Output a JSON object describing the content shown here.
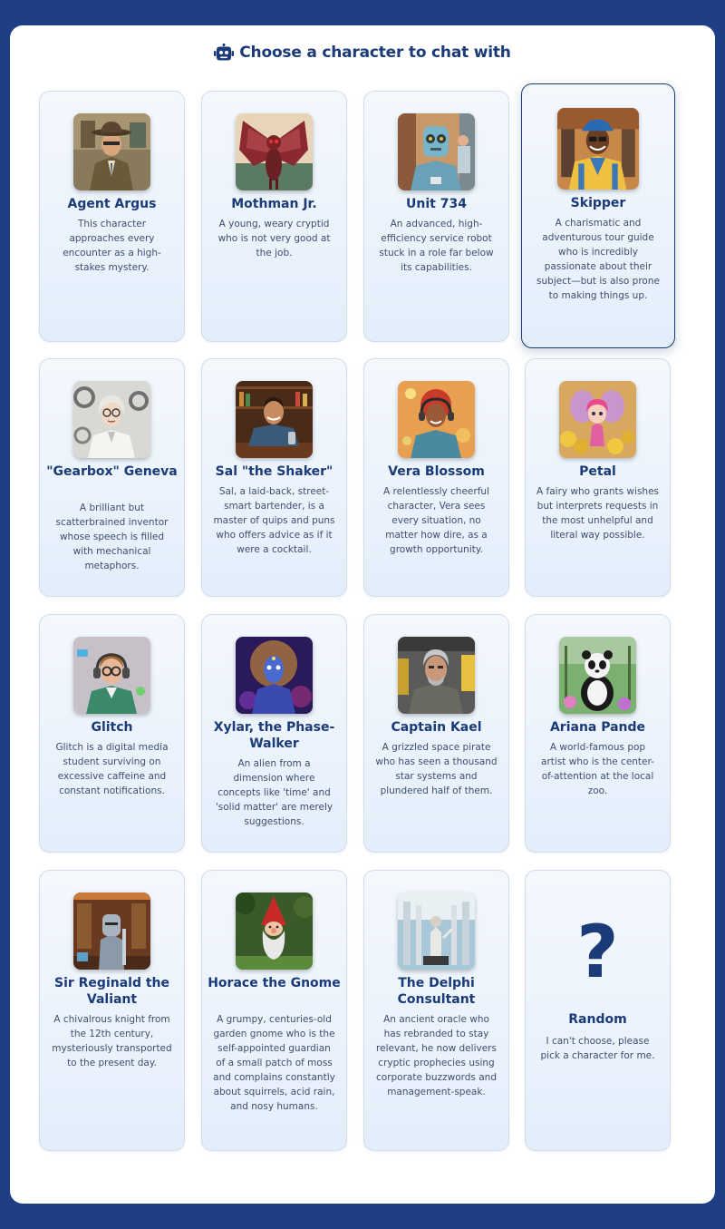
{
  "header": {
    "title": "Choose a character to chat with",
    "icon": "robot-icon"
  },
  "colors": {
    "background": "#1e3f85",
    "panel": "#ffffff",
    "accent": "#1a3a78",
    "text": "#3d4f6e"
  },
  "characters": [
    {
      "name": "Agent Argus",
      "description": "This character approaches every encounter as a high-stakes mystery.",
      "avatar_icon": "detective-avatar"
    },
    {
      "name": "Mothman Jr.",
      "description": "A young, weary cryptid who is not very good at the job.",
      "avatar_icon": "mothman-avatar"
    },
    {
      "name": "Unit 734",
      "description": "An advanced, high-efficiency service robot stuck in a role far below its capabilities.",
      "avatar_icon": "robot-avatar"
    },
    {
      "name": "Skipper",
      "description": "A charismatic and adventurous tour guide who is incredibly passionate about their subject—but is also prone to making things up.",
      "avatar_icon": "tour-guide-avatar",
      "selected": true
    },
    {
      "name": "\"Gearbox\" Geneva",
      "description": "A brilliant but scatterbrained inventor whose speech is filled with mechanical metaphors.",
      "avatar_icon": "inventor-avatar"
    },
    {
      "name": "Sal \"the Shaker\"",
      "description": "Sal, a laid-back, street-smart bartender, is a master of quips and puns who offers advice as if it were a cocktail.",
      "avatar_icon": "bartender-avatar"
    },
    {
      "name": "Vera Blossom",
      "description": "A relentlessly cheerful character, Vera sees every situation, no matter how dire, as a growth opportunity.",
      "avatar_icon": "cheerful-woman-avatar"
    },
    {
      "name": "Petal",
      "description": "A fairy who grants wishes but interprets requests in the most unhelpful and literal way possible.",
      "avatar_icon": "fairy-avatar"
    },
    {
      "name": "Glitch",
      "description": "Glitch is a digital media student surviving on excessive caffeine and constant notifications.",
      "avatar_icon": "student-avatar"
    },
    {
      "name": "Xylar, the Phase-Walker",
      "description": "An alien from a dimension where concepts like 'time' and 'solid matter' are merely suggestions.",
      "avatar_icon": "alien-avatar"
    },
    {
      "name": "Captain Kael",
      "description": "A grizzled space pirate who has seen a thousand star systems and plundered half of them.",
      "avatar_icon": "space-pirate-avatar"
    },
    {
      "name": "Ariana Pande",
      "description": "A world-famous pop artist who is the center-of-attention at the local zoo.",
      "avatar_icon": "panda-avatar"
    },
    {
      "name": "Sir Reginald the Valiant",
      "description": "A chivalrous knight from the 12th century, mysteriously transported to the present day.",
      "avatar_icon": "knight-avatar"
    },
    {
      "name": "Horace the Gnome",
      "description": "A grumpy, centuries-old garden gnome who is the self-appointed guardian of a small patch of moss and complains constantly about squirrels, acid rain, and nosy humans.",
      "avatar_icon": "gnome-avatar"
    },
    {
      "name": "The Delphi Consultant",
      "description": "An ancient oracle who has rebranded to stay relevant, he now delivers cryptic prophecies using corporate buzzwords and management-speak.",
      "avatar_icon": "oracle-avatar"
    },
    {
      "name": "Random",
      "description": "I can't choose, please pick a character for me.",
      "symbol": "?"
    }
  ]
}
